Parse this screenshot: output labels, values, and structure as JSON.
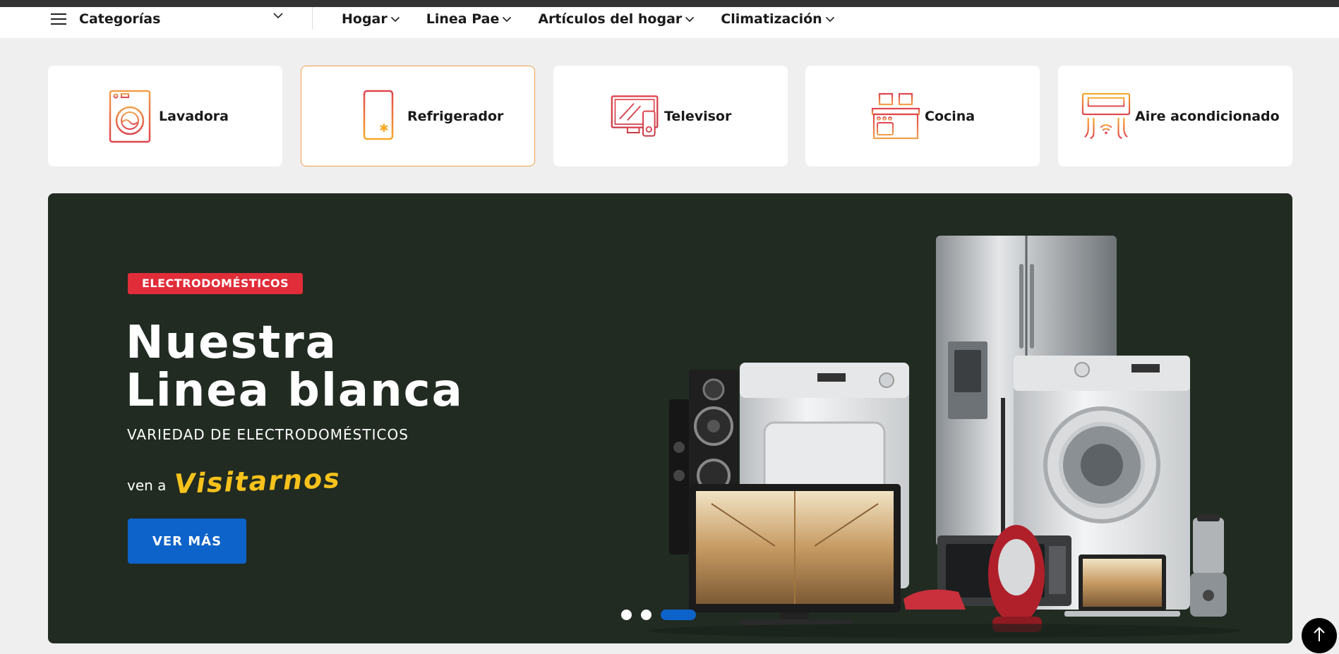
{
  "nav": {
    "categories_label": "Categorías",
    "links": [
      {
        "label": "Hogar"
      },
      {
        "label": "Linea Pae"
      },
      {
        "label": "Artículos del hogar"
      },
      {
        "label": "Climatización"
      }
    ]
  },
  "categories": [
    {
      "label": "Lavadora",
      "icon": "washing-machine-icon"
    },
    {
      "label": "Refrigerador",
      "icon": "refrigerator-icon",
      "active": true
    },
    {
      "label": "Televisor",
      "icon": "television-icon"
    },
    {
      "label": "Cocina",
      "icon": "stove-icon"
    },
    {
      "label": "Aire acondicionado",
      "icon": "air-conditioner-icon"
    }
  ],
  "banner": {
    "badge": "ELECTRODOMÉSTICOS",
    "title_line1": "Nuestra",
    "title_line2": "Linea blanca",
    "subtitle": "VARIEDAD DE ELECTRODOMÉSTICOS",
    "cta_prefix": "ven a",
    "cta_word": "Visitarnos",
    "button_label": "VER MÁS",
    "slides": 3,
    "active_slide": 3
  },
  "colors": {
    "banner_bg": "#212b22",
    "badge": "#e12d39",
    "accent_yellow": "#f7c21b",
    "button_blue": "#0d63c9",
    "icon_orange": "#f0a04b",
    "icon_red": "#e0454f"
  }
}
